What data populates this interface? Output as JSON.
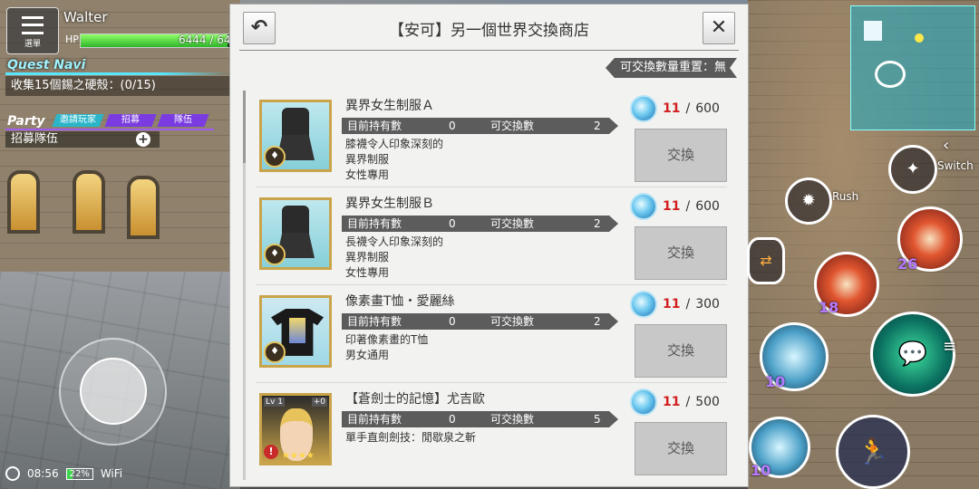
{
  "player": {
    "name": "Walter",
    "hp_label": "HP",
    "hp_value": "6444 / 64",
    "hp_fraction": 0.98
  },
  "menu": {
    "label": "選單"
  },
  "quest": {
    "title": "Quest Navi",
    "text": "收集15個錫之硬殼：(0/15)"
  },
  "party": {
    "title": "Party",
    "tabs": [
      "邀請玩家",
      "招募",
      "隊伍"
    ],
    "recruit": "招募隊伍"
  },
  "status": {
    "time": "08:56",
    "battery": "22%",
    "wifi": "WiFi"
  },
  "shop": {
    "title": "【安可】另一個世界交換商店",
    "reset_note": "可交換數量重置：無",
    "items": [
      {
        "name": "異界女生制服Ａ",
        "owned_label": "目前持有數",
        "owned": "0",
        "exchangeable_label": "可交換數",
        "exchangeable": "2",
        "desc": [
          "膝襪令人印象深刻的",
          "異界制服",
          "女性專用"
        ],
        "have": "11",
        "sep": "/",
        "need": "600",
        "button": "交換"
      },
      {
        "name": "異界女生制服Ｂ",
        "owned_label": "目前持有數",
        "owned": "0",
        "exchangeable_label": "可交換數",
        "exchangeable": "2",
        "desc": [
          "長襪令人印象深刻的",
          "異界制服",
          "女性專用"
        ],
        "have": "11",
        "sep": "/",
        "need": "600",
        "button": "交換"
      },
      {
        "name": "像素畫T恤・愛麗絲",
        "owned_label": "目前持有數",
        "owned": "0",
        "exchangeable_label": "可交換數",
        "exchangeable": "2",
        "desc": [
          "印著像素畫的T恤",
          "男女通用"
        ],
        "have": "11",
        "sep": "/",
        "need": "300",
        "button": "交換"
      },
      {
        "name": "【蒼劍士的記憶】尤吉歐",
        "owned_label": "目前持有數",
        "owned": "0",
        "exchangeable_label": "可交換數",
        "exchangeable": "5",
        "desc": [
          "單手直劍劍技：閒歇泉之斬"
        ],
        "have": "11",
        "sep": "/",
        "need": "500",
        "button": "交換",
        "hero_level": "Lv 1",
        "hero_plus": "+0",
        "stars": "★★★★",
        "warn": "!"
      }
    ],
    "item_badges": [
      "♦",
      "♦",
      "♦"
    ]
  },
  "hud": {
    "switch_label": "Switch",
    "rush_label": "Rush",
    "counts": [
      "26",
      "18",
      "10",
      "10"
    ],
    "chevron": "‹",
    "menu_lines": "≡"
  },
  "colors": {
    "accent": "#58e6ff",
    "party": "#a35bf5",
    "cost_have": "#d21f1f"
  }
}
